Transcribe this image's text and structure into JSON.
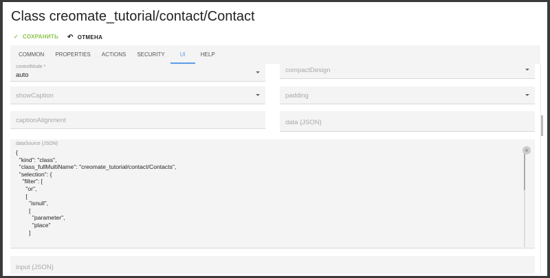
{
  "dialog": {
    "title": "Class creomate_tutorial/contact/Contact"
  },
  "toolbar": {
    "save_label": "СОХРАНИТЬ",
    "cancel_label": "ОТМЕНА",
    "save_color": "#8bc34a"
  },
  "tabs": [
    {
      "label": "COMMON"
    },
    {
      "label": "PROPERTIES"
    },
    {
      "label": "ACTIONS"
    },
    {
      "label": "SECURITY"
    },
    {
      "label": "UI",
      "active": true
    },
    {
      "label": "HELP"
    }
  ],
  "fields": {
    "controlMode": {
      "label": "controlMode *",
      "value": "auto"
    },
    "compactDesign": {
      "placeholder": "compactDesign"
    },
    "showCaption": {
      "placeholder": "showCaption"
    },
    "padding": {
      "placeholder": "padding"
    },
    "captionAlignment": {
      "placeholder": "captionAlignment"
    },
    "data": {
      "placeholder": "data {JSON}"
    },
    "dataSource": {
      "label": "dataSource {JSON}",
      "value": "{\n  \"kind\": \"class\",\n  \"class_fullMultiName\": \"creomate_tutorial/contact/Contacts\",\n  \"selection\": {\n    \"filter\": [\n      \"or\",\n      [\n        \"isnull\",\n        [\n          \"parameter\",\n          \"place\"\n        ]"
    },
    "input": {
      "placeholder": "input {JSON}"
    }
  },
  "accent": "#5c9ce6"
}
